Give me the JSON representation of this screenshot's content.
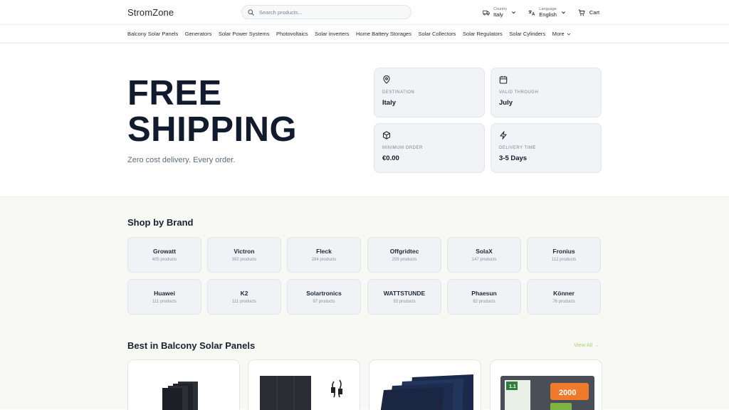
{
  "header": {
    "logo": "StromZone",
    "search_placeholder": "Search products...",
    "country_label": "Country",
    "country_value": "Italy",
    "language_label": "Language",
    "language_value": "English",
    "cart_label": "Cart"
  },
  "nav": {
    "items": [
      {
        "label": "Balcony Solar Panels"
      },
      {
        "label": "Generators"
      },
      {
        "label": "Solar Power Systems"
      },
      {
        "label": "Photovoltaics"
      },
      {
        "label": "Solar inverters"
      },
      {
        "label": "Home Battery Storages"
      },
      {
        "label": "Solar Collectors"
      },
      {
        "label": "Solar Regulators"
      },
      {
        "label": "Solar Cylinders"
      }
    ],
    "more": "More"
  },
  "hero": {
    "title_line1": "FREE",
    "title_line2": "SHIPPING",
    "subtitle": "Zero cost delivery. Every order.",
    "cards": [
      {
        "icon": "map-pin-icon",
        "label": "DESTINATION",
        "value": "Italy"
      },
      {
        "icon": "calendar-icon",
        "label": "VALID THROUGH",
        "value": "July"
      },
      {
        "icon": "package-icon",
        "label": "MINIMUM ORDER",
        "value": "€0.00"
      },
      {
        "icon": "lightning-icon",
        "label": "DELIVERY TIME",
        "value": "3-5 Days"
      }
    ]
  },
  "brands": {
    "title": "Shop by Brand",
    "items": [
      {
        "name": "Growatt",
        "count": "405 products"
      },
      {
        "name": "Victron",
        "count": "392 products"
      },
      {
        "name": "Fleck",
        "count": "284 products"
      },
      {
        "name": "Offgridtec",
        "count": "259 products"
      },
      {
        "name": "SolaX",
        "count": "147 products"
      },
      {
        "name": "Fronius",
        "count": "112 products"
      },
      {
        "name": "Huawei",
        "count": "111 products"
      },
      {
        "name": "K2",
        "count": "111 products"
      },
      {
        "name": "Solartronics",
        "count": "97 products"
      },
      {
        "name": "WATTSTUNDE",
        "count": "93 products"
      },
      {
        "name": "Phaesun",
        "count": "82 products"
      },
      {
        "name": "Könner",
        "count": "76 products"
      }
    ]
  },
  "best": {
    "title": "Best in Balcony Solar Panels",
    "view_all": "View All →",
    "badge_top": "1.1",
    "badge_power": "2000"
  },
  "colors": {
    "accent": "#a3d96a",
    "text_dark": "#121a2e",
    "card_bg": "#f1f3f6",
    "section_bg": "#f8f8f5"
  }
}
